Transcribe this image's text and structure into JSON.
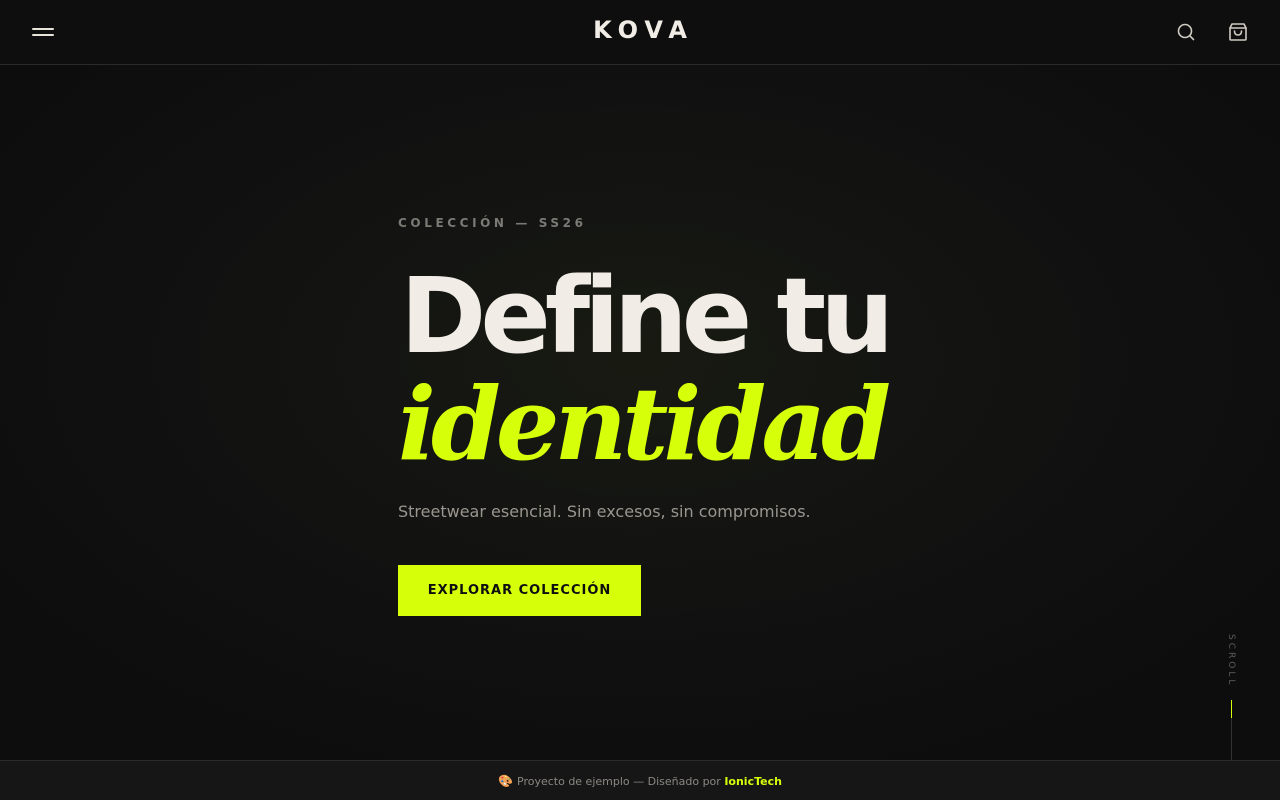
{
  "header": {
    "brand": "KOVA",
    "icons": {
      "menu": "hamburger-menu-icon",
      "search": "search-icon",
      "bag": "shopping-bag-icon"
    }
  },
  "hero": {
    "eyebrow": "COLECCIÓN — SS26",
    "title_line1": "Define tu",
    "title_line2": "identidad",
    "subtitle": "Streetwear esencial. Sin excesos, sin compromisos.",
    "cta_label": "EXPLORAR COLECCIÓN"
  },
  "scroll": {
    "label": "SCROLL"
  },
  "footer": {
    "emoji": "🎨",
    "text": "Proyecto de ejemplo — Diseñado por",
    "credit": "IonicTech"
  },
  "colors": {
    "background": "#0f0f0f",
    "accent": "#d6ff0a",
    "text": "#f1ede6",
    "muted": "#9a968f"
  }
}
